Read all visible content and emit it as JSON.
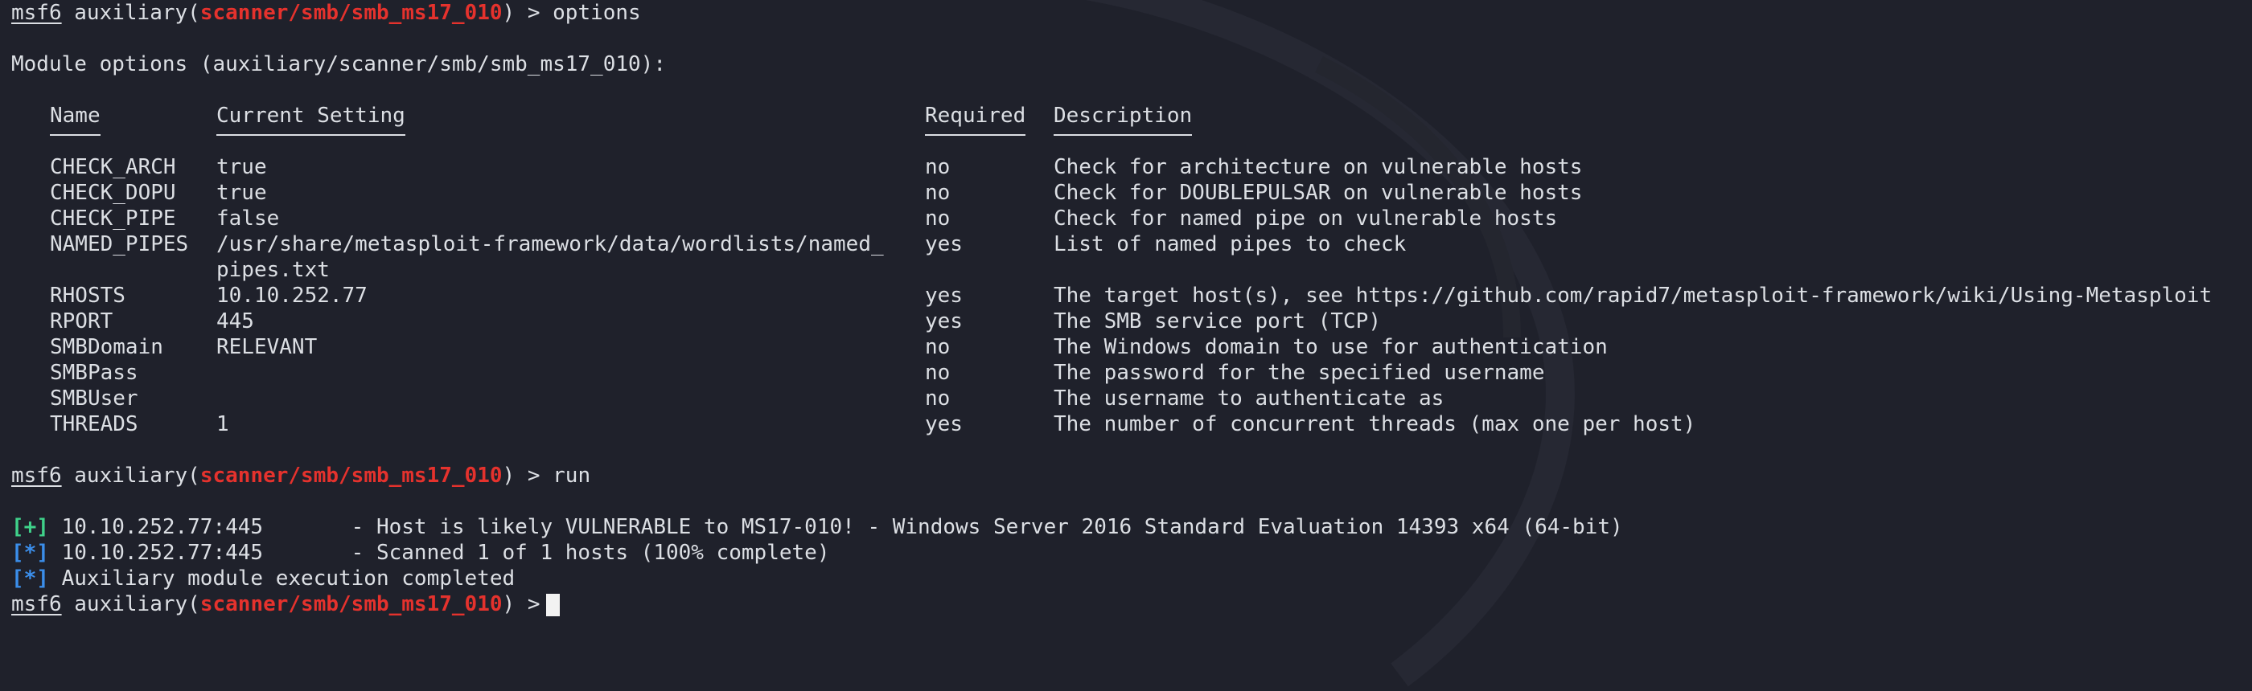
{
  "prompt": {
    "name": "msf6",
    "module_type": "auxiliary",
    "module_path": "scanner/smb/smb_ms17_010"
  },
  "commands": [
    "options",
    "run"
  ],
  "module_options": {
    "heading": "Module options (auxiliary/scanner/smb/smb_ms17_010):",
    "columns": [
      "Name",
      "Current Setting",
      "Required",
      "Description"
    ],
    "rows": [
      {
        "name": "CHECK_ARCH",
        "setting": "true",
        "setting_cont": "",
        "required": "no",
        "description": "Check for architecture on vulnerable hosts"
      },
      {
        "name": "CHECK_DOPU",
        "setting": "true",
        "setting_cont": "",
        "required": "no",
        "description": "Check for DOUBLEPULSAR on vulnerable hosts"
      },
      {
        "name": "CHECK_PIPE",
        "setting": "false",
        "setting_cont": "",
        "required": "no",
        "description": "Check for named pipe on vulnerable hosts"
      },
      {
        "name": "NAMED_PIPES",
        "setting": "/usr/share/metasploit-framework/data/wordlists/named_",
        "setting_cont": "pipes.txt",
        "required": "yes",
        "description": "List of named pipes to check"
      },
      {
        "name": "RHOSTS",
        "setting": "10.10.252.77",
        "setting_cont": "",
        "required": "yes",
        "description": "The target host(s), see https://github.com/rapid7/metasploit-framework/wiki/Using-Metasploit"
      },
      {
        "name": "RPORT",
        "setting": "445",
        "setting_cont": "",
        "required": "yes",
        "description": "The SMB service port (TCP)"
      },
      {
        "name": "SMBDomain",
        "setting": "RELEVANT",
        "setting_cont": "",
        "required": "no",
        "description": "The Windows domain to use for authentication"
      },
      {
        "name": "SMBPass",
        "setting": "",
        "setting_cont": "",
        "required": "no",
        "description": "The password for the specified username"
      },
      {
        "name": "SMBUser",
        "setting": "",
        "setting_cont": "",
        "required": "no",
        "description": "The username to authenticate as"
      },
      {
        "name": "THREADS",
        "setting": "1",
        "setting_cont": "",
        "required": "yes",
        "description": "The number of concurrent threads (max one per host)"
      }
    ]
  },
  "run_output": [
    {
      "marker": "[+]",
      "marker_color": "green",
      "text": "10.10.252.77:445       - Host is likely VULNERABLE to MS17-010! - Windows Server 2016 Standard Evaluation 14393 x64 (64-bit)"
    },
    {
      "marker": "[*]",
      "marker_color": "blue",
      "text": "10.10.252.77:445       - Scanned 1 of 1 hosts (100% complete)"
    },
    {
      "marker": "[*]",
      "marker_color": "blue",
      "text": "Auxiliary module execution completed"
    }
  ],
  "colors": {
    "background": "#1f212b",
    "text": "#dcdfe4",
    "module_path": "#e5322d",
    "success_marker": "#3fd18a",
    "info_marker": "#3b8eea"
  }
}
